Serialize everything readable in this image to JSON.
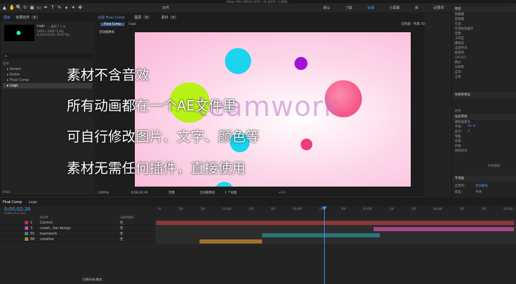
{
  "app": {
    "title": "Adobe After Effects 2020 - AE 源文件（已转换）"
  },
  "toolbar": {
    "tools": [
      "▲",
      "✋",
      "🔍",
      "↻",
      "▣",
      "▭",
      "✒",
      "T",
      "✎",
      "⬧",
      "✦",
      "✤"
    ],
    "snap_label": "对齐",
    "workspaces": [
      "默认",
      "了解",
      "标准",
      "小屏幕",
      "库",
      "必要项"
    ],
    "active_workspace": "标准",
    "search_label": "搜索帮助"
  },
  "project": {
    "tabs": [
      "项目",
      "效果控件（无）"
    ],
    "comp_name": "Logo",
    "comp_used": "，使用了 1 次",
    "comp_info": "1920 x 1080 (1.00)\nΔ 0;00;10;00, 29.97 fps",
    "search_placeholder": "ρ.",
    "column_name": "名称",
    "files": [
      "Assets",
      "Solids",
      "Final Comp",
      "Logo"
    ],
    "selected_file": "Logo",
    "bpc": "8 bpc"
  },
  "composition": {
    "panel_tab": "合成 Final Comp",
    "sub_tabs": [
      "Final Comp",
      "Logo"
    ],
    "layer_label": "图层（无）",
    "footage_label": "素材（无）",
    "camera_label": "活动摄像机",
    "renderer_label": "渲染器：经典 3D",
    "zoom": "(100%)",
    "time": "0;00;02;26",
    "quality": "完整",
    "view": "活动摄像机",
    "views": "1 个视图",
    "offset": "+0.0"
  },
  "overlay": {
    "line1": "素材不含音效",
    "line2": "所有动画都在一个AE文件里",
    "line3": "可自行修改图片、文字、颜色等",
    "line4": "素材无需任何插件，直接使用"
  },
  "canvas": {
    "watermark": "teamwork",
    "colors": {
      "cyan": "#1ad4f0",
      "purple": "#a312d8",
      "lime": "#b8f218",
      "pink": "#ee3d7a"
    }
  },
  "right_panel": {
    "info_tab": "信息",
    "audio_tab": "音频",
    "preview_tab": "预览",
    "preview_items": [
      "快捷键",
      "空格键",
      "包含：",
      "在回放前缓存",
      "范围",
      "工作区",
      "播放自",
      "当前时间",
      "帧速率",
      "(29.97)",
      "跳过",
      "分辨率",
      "自动",
      "全屏"
    ],
    "effects_tab": "效果和预设",
    "align_tab": "对齐",
    "motion_tab": "动态草图",
    "motion_items": [
      "捕捉速度为：",
      "平滑：",
      "显示：",
      "线框",
      "背景",
      "开始",
      "持续时间"
    ],
    "capture_value": "61 %",
    "smooth_value": "1",
    "start_btn": "开始捕捉",
    "smooth_tab": "平滑器",
    "smooth_items": [
      "应用到：",
      "容差："
    ],
    "smooth_apply": "空间路径",
    "tolerance": "平滑"
  },
  "timeline": {
    "tabs": [
      "Final Comp",
      "Logo"
    ],
    "time": "0;00;02;26",
    "frames": "00086 (29.97 fps)",
    "column_source": "源名称",
    "column_parent": "父级和链接",
    "layers": [
      {
        "index": "1",
        "name": "Control",
        "parent": "无",
        "color": "#b23a3a"
      },
      {
        "index": "3",
        "name": "creati...ital design",
        "parent": "无",
        "color": "#c84aa6"
      },
      {
        "index": "65",
        "name": "teamwork",
        "parent": "无",
        "color": "#2a8a8e"
      },
      {
        "index": "88",
        "name": "creative",
        "parent": "无",
        "color": "#b8802a"
      }
    ],
    "bottom_label": "切换开关/模式",
    "ruler": [
      "0f",
      "10f",
      "20f",
      "01:00f",
      "10f",
      "20f",
      "02:00f",
      "10f",
      "20f",
      "03:00f",
      "10f",
      "20f",
      "04:00f",
      "10f",
      "20f",
      "05:00f"
    ]
  }
}
